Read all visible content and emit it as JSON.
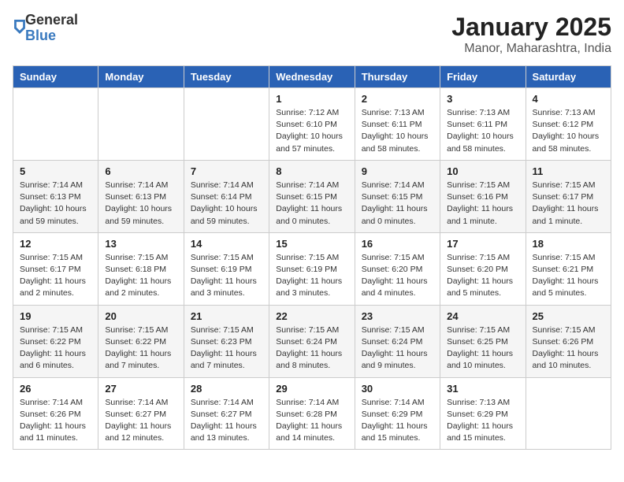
{
  "logo": {
    "general": "General",
    "blue": "Blue"
  },
  "title": "January 2025",
  "location": "Manor, Maharashtra, India",
  "days_of_week": [
    "Sunday",
    "Monday",
    "Tuesday",
    "Wednesday",
    "Thursday",
    "Friday",
    "Saturday"
  ],
  "weeks": [
    [
      {
        "day": "",
        "info": ""
      },
      {
        "day": "",
        "info": ""
      },
      {
        "day": "",
        "info": ""
      },
      {
        "day": "1",
        "info": "Sunrise: 7:12 AM\nSunset: 6:10 PM\nDaylight: 10 hours and 57 minutes."
      },
      {
        "day": "2",
        "info": "Sunrise: 7:13 AM\nSunset: 6:11 PM\nDaylight: 10 hours and 58 minutes."
      },
      {
        "day": "3",
        "info": "Sunrise: 7:13 AM\nSunset: 6:11 PM\nDaylight: 10 hours and 58 minutes."
      },
      {
        "day": "4",
        "info": "Sunrise: 7:13 AM\nSunset: 6:12 PM\nDaylight: 10 hours and 58 minutes."
      }
    ],
    [
      {
        "day": "5",
        "info": "Sunrise: 7:14 AM\nSunset: 6:13 PM\nDaylight: 10 hours and 59 minutes."
      },
      {
        "day": "6",
        "info": "Sunrise: 7:14 AM\nSunset: 6:13 PM\nDaylight: 10 hours and 59 minutes."
      },
      {
        "day": "7",
        "info": "Sunrise: 7:14 AM\nSunset: 6:14 PM\nDaylight: 10 hours and 59 minutes."
      },
      {
        "day": "8",
        "info": "Sunrise: 7:14 AM\nSunset: 6:15 PM\nDaylight: 11 hours and 0 minutes."
      },
      {
        "day": "9",
        "info": "Sunrise: 7:14 AM\nSunset: 6:15 PM\nDaylight: 11 hours and 0 minutes."
      },
      {
        "day": "10",
        "info": "Sunrise: 7:15 AM\nSunset: 6:16 PM\nDaylight: 11 hours and 1 minute."
      },
      {
        "day": "11",
        "info": "Sunrise: 7:15 AM\nSunset: 6:17 PM\nDaylight: 11 hours and 1 minute."
      }
    ],
    [
      {
        "day": "12",
        "info": "Sunrise: 7:15 AM\nSunset: 6:17 PM\nDaylight: 11 hours and 2 minutes."
      },
      {
        "day": "13",
        "info": "Sunrise: 7:15 AM\nSunset: 6:18 PM\nDaylight: 11 hours and 2 minutes."
      },
      {
        "day": "14",
        "info": "Sunrise: 7:15 AM\nSunset: 6:19 PM\nDaylight: 11 hours and 3 minutes."
      },
      {
        "day": "15",
        "info": "Sunrise: 7:15 AM\nSunset: 6:19 PM\nDaylight: 11 hours and 3 minutes."
      },
      {
        "day": "16",
        "info": "Sunrise: 7:15 AM\nSunset: 6:20 PM\nDaylight: 11 hours and 4 minutes."
      },
      {
        "day": "17",
        "info": "Sunrise: 7:15 AM\nSunset: 6:20 PM\nDaylight: 11 hours and 5 minutes."
      },
      {
        "day": "18",
        "info": "Sunrise: 7:15 AM\nSunset: 6:21 PM\nDaylight: 11 hours and 5 minutes."
      }
    ],
    [
      {
        "day": "19",
        "info": "Sunrise: 7:15 AM\nSunset: 6:22 PM\nDaylight: 11 hours and 6 minutes."
      },
      {
        "day": "20",
        "info": "Sunrise: 7:15 AM\nSunset: 6:22 PM\nDaylight: 11 hours and 7 minutes."
      },
      {
        "day": "21",
        "info": "Sunrise: 7:15 AM\nSunset: 6:23 PM\nDaylight: 11 hours and 7 minutes."
      },
      {
        "day": "22",
        "info": "Sunrise: 7:15 AM\nSunset: 6:24 PM\nDaylight: 11 hours and 8 minutes."
      },
      {
        "day": "23",
        "info": "Sunrise: 7:15 AM\nSunset: 6:24 PM\nDaylight: 11 hours and 9 minutes."
      },
      {
        "day": "24",
        "info": "Sunrise: 7:15 AM\nSunset: 6:25 PM\nDaylight: 11 hours and 10 minutes."
      },
      {
        "day": "25",
        "info": "Sunrise: 7:15 AM\nSunset: 6:26 PM\nDaylight: 11 hours and 10 minutes."
      }
    ],
    [
      {
        "day": "26",
        "info": "Sunrise: 7:14 AM\nSunset: 6:26 PM\nDaylight: 11 hours and 11 minutes."
      },
      {
        "day": "27",
        "info": "Sunrise: 7:14 AM\nSunset: 6:27 PM\nDaylight: 11 hours and 12 minutes."
      },
      {
        "day": "28",
        "info": "Sunrise: 7:14 AM\nSunset: 6:27 PM\nDaylight: 11 hours and 13 minutes."
      },
      {
        "day": "29",
        "info": "Sunrise: 7:14 AM\nSunset: 6:28 PM\nDaylight: 11 hours and 14 minutes."
      },
      {
        "day": "30",
        "info": "Sunrise: 7:14 AM\nSunset: 6:29 PM\nDaylight: 11 hours and 15 minutes."
      },
      {
        "day": "31",
        "info": "Sunrise: 7:13 AM\nSunset: 6:29 PM\nDaylight: 11 hours and 15 minutes."
      },
      {
        "day": "",
        "info": ""
      }
    ]
  ]
}
